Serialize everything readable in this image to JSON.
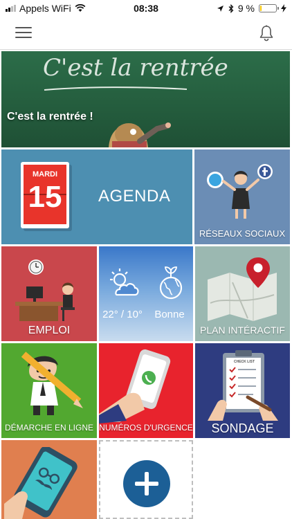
{
  "status_bar": {
    "carrier": "Appels WiFi",
    "time": "08:38",
    "battery_percent_text": "9 %",
    "battery_level": 0.09,
    "battery_color": "#f5c400"
  },
  "nav": {
    "menu_icon": "hamburger-menu-icon",
    "bell_icon": "bell-icon"
  },
  "hero": {
    "chalkboard_text": "C'est la rentrée",
    "caption": "C'est la rentrée !",
    "slides_total": 1,
    "active_slide": 1
  },
  "tiles": {
    "agenda": {
      "calendar_month": "MARDI",
      "calendar_day": "15",
      "label": "AGENDA",
      "color": "#4d8fb1"
    },
    "reseaux": {
      "label": "RÉSEAUX SOCIAUX",
      "color": "#6b8db5"
    },
    "emploi": {
      "label": "EMPLOI",
      "color": "#c9474c"
    },
    "meteo": {
      "temperature": "22° / 10°",
      "air_quality": "Bonne"
    },
    "plan": {
      "label": "PLAN INTÉRACTIF",
      "color": "#9bb8b1"
    },
    "demarche": {
      "label": "DÉMARCHE EN LIGNE",
      "color": "#52a830"
    },
    "urgence": {
      "label": "NUMÉROS D'URGENCE",
      "color": "#e8232d"
    },
    "sondage": {
      "label": "SONDAGE",
      "clipboard_text": "CHECK LIST",
      "color": "#2e3c80"
    },
    "portrait": {
      "color": "#e07f4f"
    },
    "add": {
      "icon": "plus-icon",
      "color": "#1c5f96"
    }
  }
}
